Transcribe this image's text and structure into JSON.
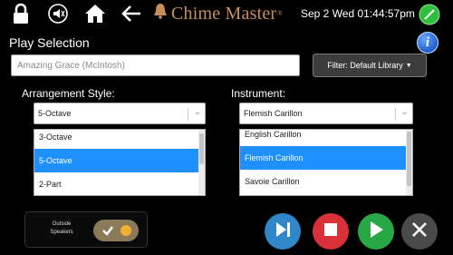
{
  "header": {
    "icons": [
      "lock-icon",
      "speaker-muted-icon",
      "home-icon",
      "back-arrow-icon",
      "bell-icon",
      "status-ok-icon"
    ],
    "brand": "Chime Master",
    "brand_mark": "®",
    "datetime": "Sep 2 Wed 01:44:57pm"
  },
  "play_selection": {
    "title": "Play Selection",
    "search_value": "Amazing Grace (McIntosh)",
    "filter_label": "Filter: Default Library"
  },
  "arrangement": {
    "label": "Arrangement Style:",
    "selected": "5-Octave",
    "options": [
      "3-Octave",
      "5-Octave",
      "2-Part"
    ],
    "selected_index": 1
  },
  "instrument": {
    "label": "Instrument:",
    "selected": "Flemish Carillon",
    "options": [
      "English Carillon",
      "Flemish Carillon",
      "Savoie Carillon"
    ],
    "selected_index": 1
  },
  "outside_speakers": {
    "label_line1": "Outside",
    "label_line2": "Speakers",
    "enabled": true
  },
  "controls": {
    "colors": {
      "play_next": "#2f86c8",
      "stop": "#d9313a",
      "play": "#27a845",
      "close": "#4a4a4a"
    }
  }
}
